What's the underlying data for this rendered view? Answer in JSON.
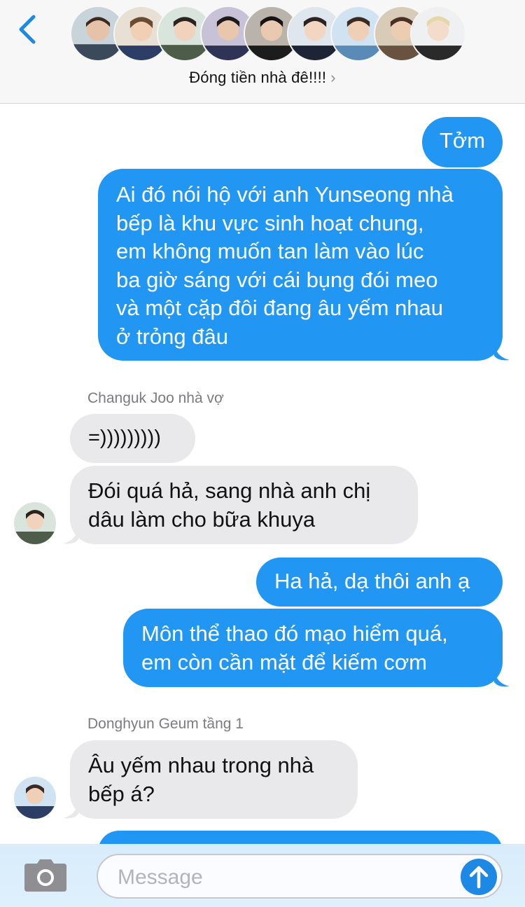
{
  "header": {
    "group_name": "Đóng tiền nhà đê!!!!",
    "chevron": "›",
    "avatar_count": 9
  },
  "messages": [
    {
      "type": "sent",
      "lines": [
        "Tởm"
      ]
    },
    {
      "type": "sent",
      "lines": [
        "Ai đó nói hộ với anh Yunseong nhà",
        "bếp là khu vực sinh hoạt chung,",
        "em không muốn tan làm vào lúc",
        "ba giờ sáng với cái bụng đói meo",
        "và một cặp đôi đang âu yếm nhau",
        "ở trỏng đâu"
      ]
    },
    {
      "type": "sender",
      "text": "Changuk Joo nhà vợ"
    },
    {
      "type": "received",
      "lines": [
        "=)))))))))"
      ]
    },
    {
      "type": "received",
      "lines": [
        "Đói quá hả, sang nhà anh chị",
        "dâu làm cho bữa khuya"
      ]
    },
    {
      "type": "sent",
      "lines": [
        "Ha hả, dạ thôi anh ạ"
      ]
    },
    {
      "type": "sent",
      "lines": [
        "Môn thể thao đó mạo hiểm quá,",
        "em còn cần mặt để kiếm cơm"
      ]
    },
    {
      "type": "sender",
      "text": "Donghyun Geum tầng 1"
    },
    {
      "type": "received",
      "lines": [
        "Âu yếm nhau trong nhà",
        "bếp á?"
      ]
    }
  ],
  "input": {
    "placeholder": "Message"
  },
  "colors": {
    "sent_bubble": "#2196f3",
    "received_bubble": "#e9e9eb",
    "accent": "#1e88e5"
  },
  "icons": [
    "back-chevron-icon",
    "camera-icon",
    "send-arrow-icon"
  ]
}
